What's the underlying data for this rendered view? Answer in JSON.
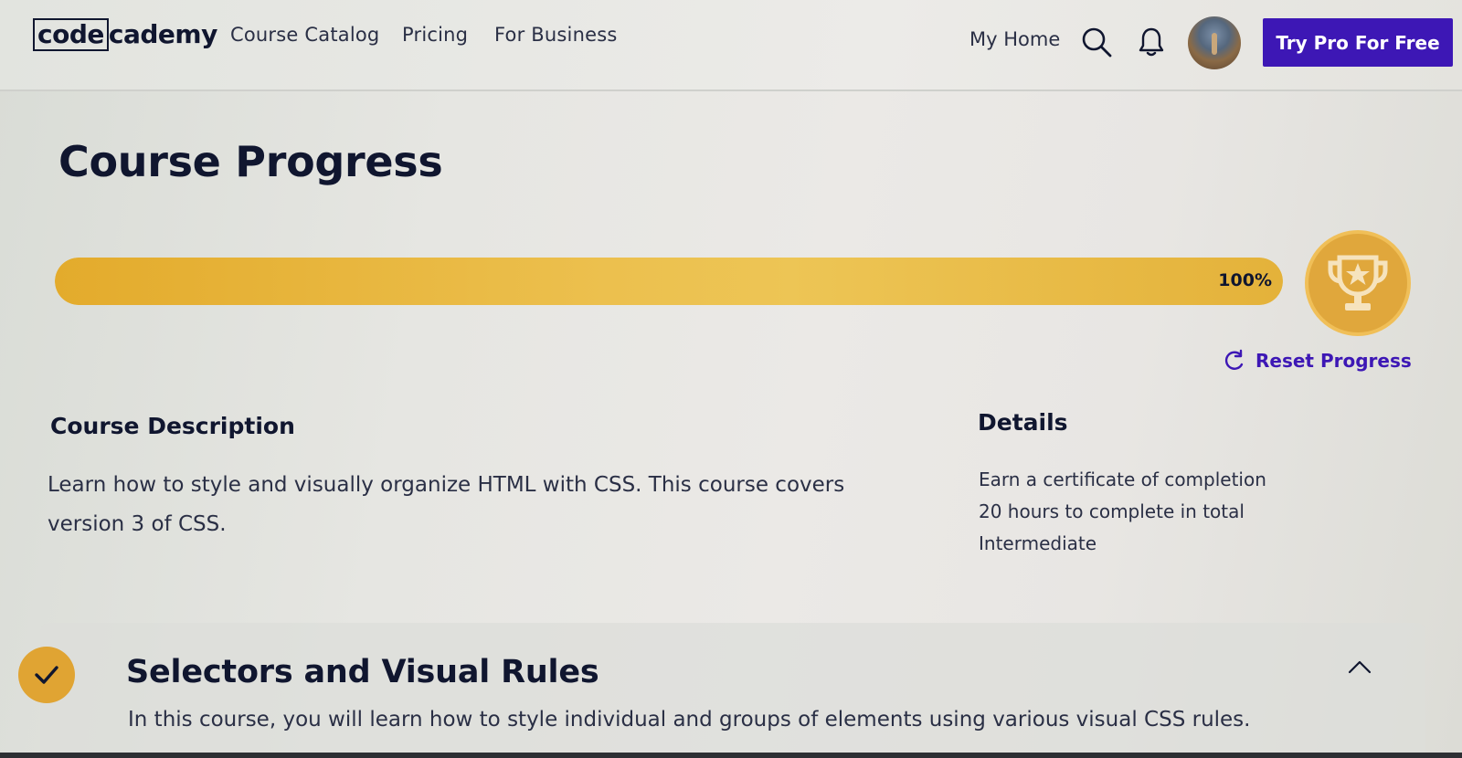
{
  "header": {
    "logo_code": "code",
    "logo_cademy": "cademy",
    "nav": [
      {
        "label": "Course Catalog"
      },
      {
        "label": "Pricing"
      },
      {
        "label": "For Business"
      }
    ],
    "my_home": "My Home",
    "search_icon": "search-icon",
    "bell_icon": "bell-icon",
    "cta_label": "Try Pro For Free",
    "cta_color": "#3d17b5"
  },
  "progress": {
    "title": "Course Progress",
    "percent_label": "100%",
    "value": 1.0,
    "fill_color": "#ecc04e",
    "reset_label": "Reset Progress"
  },
  "description": {
    "heading": "Course Description",
    "text": "Learn how to style and visually organize HTML with CSS. This course covers version 3 of CSS."
  },
  "details": {
    "heading": "Details",
    "items": [
      "Earn a certificate of completion",
      "20 hours to complete in total",
      "Intermediate"
    ]
  },
  "module": {
    "title": "Selectors and Visual Rules",
    "description": "In this course, you will learn how to style individual and groups of elements using various visual CSS rules.",
    "completed": true,
    "expanded": true
  }
}
